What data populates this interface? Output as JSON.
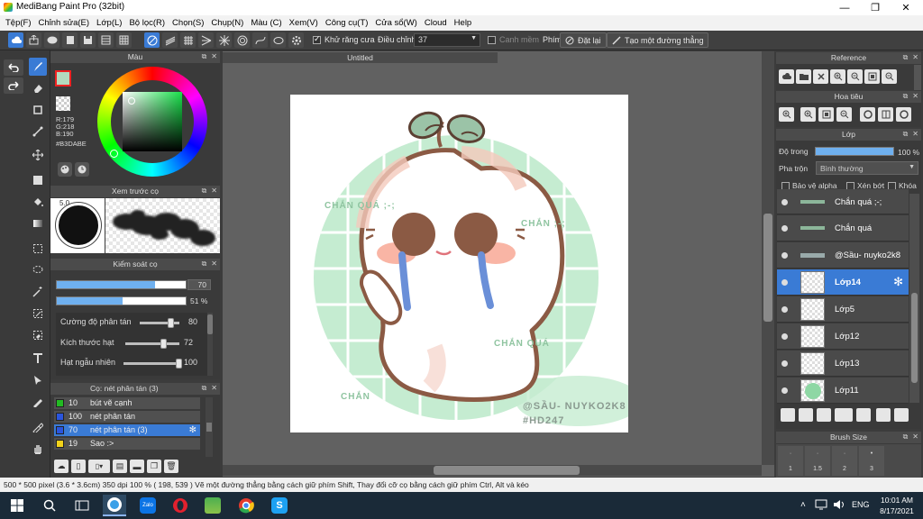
{
  "window": {
    "title": "MediBang Paint Pro (32bit)",
    "minimize": "—",
    "maximize": "❐",
    "close": "✕"
  },
  "menu": [
    "Tệp(F)",
    "Chỉnh sửa(E)",
    "Lớp(L)",
    "Bộ lọc(R)",
    "Chọn(S)",
    "Chụp(N)",
    "Màu (C)",
    "Xem(V)",
    "Công cụ(T)",
    "Cửa sổ(W)",
    "Cloud",
    "Help"
  ],
  "toolbar": {
    "antialias_label": "Khử răng cưa",
    "adjust_label": "Điều chỉnh",
    "adjust_value": "37",
    "smooth_label": "Canh mềm",
    "key_label": "Phím",
    "reset_label": "Đặt lại",
    "line_label": "Tạo một đường thẳng"
  },
  "color_panel": {
    "title": "Màu",
    "r": "R:179",
    "g": "G:218",
    "b": "B:190",
    "hex": "#B3DABE"
  },
  "brush_preview": {
    "title": "Xem trước cọ",
    "size": "5.0"
  },
  "brush_control": {
    "title": "Kiểm soát cọ",
    "size_value": "70",
    "size_fill": 0.76,
    "opacity_value": "51 %",
    "opacity_fill": 0.51,
    "params": [
      {
        "label": "Cường độ phân tán",
        "value": "80",
        "level": 0.8
      },
      {
        "label": "Kích thước hạt",
        "value": "72",
        "level": 0.72
      },
      {
        "label": "Hạt ngẫu nhiên",
        "value": "100",
        "level": 1.0
      }
    ]
  },
  "brush_list": {
    "title": "Cọ: nét phân tán (3)",
    "items": [
      {
        "num": "10",
        "name": "bút vẽ cạnh",
        "color": "#22bb22"
      },
      {
        "num": "100",
        "name": "nét phân tán",
        "color": "#2a55dd"
      },
      {
        "num": "70",
        "name": "nét phân tán (3)",
        "color": "#2a55dd"
      },
      {
        "num": "19",
        "name": "Sao :>",
        "color": "#f2d21a"
      }
    ]
  },
  "canvas": {
    "tab_title": "Untitled",
    "text_top": "CHẮN QUÁ ;-;",
    "text_right_top": "CHẮN ;-;",
    "text_right": "CHẮN QUÁ",
    "text_bottom": "CHẮN",
    "signature_1": "@SẦU- NUYKO2K8",
    "signature_2": "#HD247"
  },
  "reference_panel": {
    "title": "Reference"
  },
  "navigator_panel": {
    "title": "Hoa tiêu"
  },
  "layer_panel": {
    "title": "Lớp",
    "opacity_label": "Độ trong",
    "opacity_value": "100 %",
    "opacity_fill": 1.0,
    "blend_label": "Pha trộn",
    "blend_value": "Bình thường",
    "protect_alpha": "Bảo vệ alpha",
    "clipping": "Xén bớt",
    "lock": "Khóa",
    "layers": [
      "Chắn quá ;-;",
      "Chắn quá",
      "@Sầu- nuyko2k8",
      "Lớp14",
      "Lớp5",
      "Lớp12",
      "Lớp13",
      "Lớp11"
    ]
  },
  "brush_size_panel": {
    "title": "Brush Size",
    "sizes": [
      "1",
      "1.5",
      "2",
      "3"
    ]
  },
  "status": {
    "text": "500 * 500 pixel  (3.6 * 3.6cm)  350 dpi  100 %  ( 198, 539 )  Vẽ một đường thẳng bằng cách giữ phím Shift, Thay đổi cỡ cọ bằng cách giữ phím Ctrl, Alt và kéo"
  },
  "taskbar": {
    "lang": "ENG",
    "time": "10:01 AM",
    "date": "8/17/2021",
    "zalo": "Zalo"
  }
}
